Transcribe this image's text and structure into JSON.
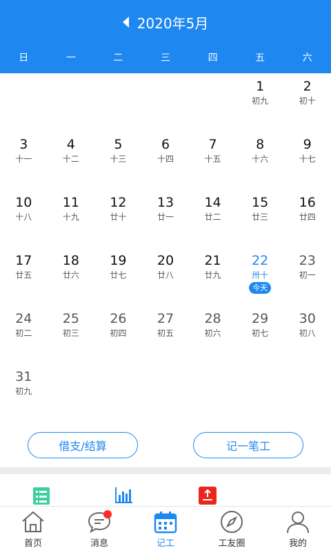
{
  "header": {
    "month_title": "2020年5月",
    "weekdays": [
      "日",
      "一",
      "二",
      "三",
      "四",
      "五",
      "六"
    ]
  },
  "calendar": {
    "days": [
      {
        "num": "",
        "lunar": ""
      },
      {
        "num": "",
        "lunar": ""
      },
      {
        "num": "",
        "lunar": ""
      },
      {
        "num": "",
        "lunar": ""
      },
      {
        "num": "",
        "lunar": ""
      },
      {
        "num": "1",
        "lunar": "初九"
      },
      {
        "num": "2",
        "lunar": "初十"
      },
      {
        "num": "3",
        "lunar": "十一"
      },
      {
        "num": "4",
        "lunar": "十二"
      },
      {
        "num": "5",
        "lunar": "十三"
      },
      {
        "num": "6",
        "lunar": "十四"
      },
      {
        "num": "7",
        "lunar": "十五"
      },
      {
        "num": "8",
        "lunar": "十六"
      },
      {
        "num": "9",
        "lunar": "十七"
      },
      {
        "num": "10",
        "lunar": "十八"
      },
      {
        "num": "11",
        "lunar": "十九"
      },
      {
        "num": "12",
        "lunar": "廿十"
      },
      {
        "num": "13",
        "lunar": "廿一"
      },
      {
        "num": "14",
        "lunar": "廿二"
      },
      {
        "num": "15",
        "lunar": "廿三"
      },
      {
        "num": "16",
        "lunar": "廿四"
      },
      {
        "num": "17",
        "lunar": "廿五"
      },
      {
        "num": "18",
        "lunar": "廿六"
      },
      {
        "num": "19",
        "lunar": "廿七"
      },
      {
        "num": "20",
        "lunar": "廿八"
      },
      {
        "num": "21",
        "lunar": "廿九"
      },
      {
        "num": "22",
        "lunar": "卅十",
        "today": true
      },
      {
        "num": "23",
        "lunar": "初一",
        "future": true
      },
      {
        "num": "24",
        "lunar": "初二",
        "future": true
      },
      {
        "num": "25",
        "lunar": "初三",
        "future": true
      },
      {
        "num": "26",
        "lunar": "初四",
        "future": true
      },
      {
        "num": "27",
        "lunar": "初五",
        "future": true
      },
      {
        "num": "28",
        "lunar": "初六",
        "future": true
      },
      {
        "num": "29",
        "lunar": "初七",
        "future": true
      },
      {
        "num": "30",
        "lunar": "初八",
        "future": true
      },
      {
        "num": "31",
        "lunar": "初九",
        "future": true
      }
    ],
    "today_label": "今天"
  },
  "actions": {
    "borrow_label": "借支/结算",
    "record_label": "记一笔工"
  },
  "tools": [
    "list-icon",
    "chart-icon",
    "upload-icon"
  ],
  "tabbar": {
    "items": [
      {
        "label": "首页",
        "icon": "home-icon"
      },
      {
        "label": "消息",
        "icon": "message-icon"
      },
      {
        "label": "记工",
        "icon": "calendar-icon"
      },
      {
        "label": "工友圈",
        "icon": "compass-icon"
      },
      {
        "label": "我的",
        "icon": "user-icon"
      }
    ],
    "active_index": 2
  },
  "colors": {
    "accent": "#1e87f0",
    "badge": "#ff2a2a",
    "tool_green": "#3ecf9e",
    "tool_red": "#e8261c"
  }
}
